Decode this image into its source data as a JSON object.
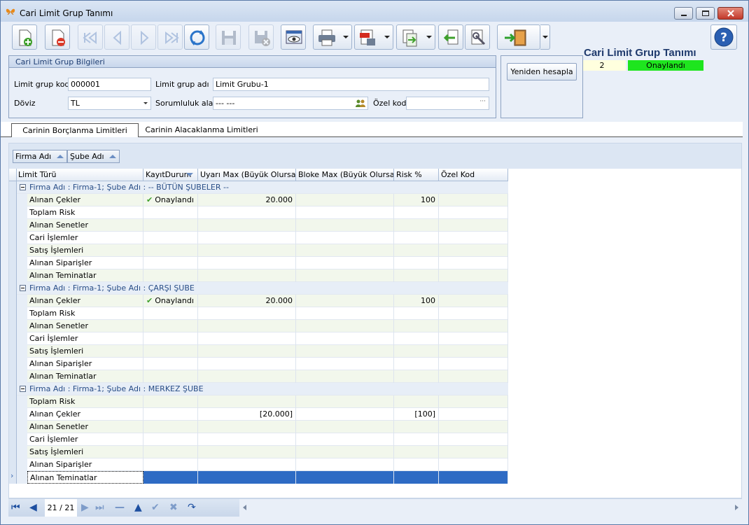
{
  "window": {
    "title": "Cari Limit Grup Tanımı"
  },
  "header": {
    "form_title": "Cari Limit Grup Tanımı",
    "record_no": "2",
    "status": "Onaylandı",
    "status_color": "#1ee51e"
  },
  "toolbar": {
    "icons": [
      "new-doc-icon",
      "delete-doc-icon",
      "first-icon",
      "prev-icon",
      "next-icon",
      "last-icon",
      "refresh-icon",
      "save-icon",
      "save-cancel-icon",
      "preview-icon",
      "print-icon",
      "pdf-icon",
      "export-icon",
      "import-icon",
      "settings-icon",
      "exit-icon",
      "help-icon"
    ]
  },
  "info": {
    "group_title": "Cari Limit Grup Bilgileri",
    "code_label": "Limit grup kodu",
    "code_value": "000001",
    "name_label": "Limit grup adı",
    "name_value": "Limit Grubu-1",
    "currency_label": "Döviz",
    "currency_value": "TL",
    "responsibility_label": "Sorumluluk alanı",
    "responsibility_value": "--- ---",
    "special_code_label": "Özel kod",
    "special_code_value": "",
    "recalc_label": "Yeniden hesapla"
  },
  "tabs": {
    "active": "Carinin Borçlanma Limitleri",
    "inactive": "Carinin Alacaklanma Limitleri"
  },
  "grouping": {
    "col1": "Firma Adı",
    "col2": "Şube Adı"
  },
  "grid": {
    "columns": [
      "Limit Türü",
      "KayıtDurum",
      "Uyarı Max (Büyük Olursa)",
      "Bloke Max (Büyük Olursa)",
      "Risk %",
      "Özel Kod"
    ],
    "groups": [
      {
        "label": "Firma Adı : Firma-1;  Şube Adı : -- BÜTÜN ŞUBELER --",
        "rows": [
          {
            "type": "Alınan Çekler",
            "status": "Onaylandı",
            "warn": "20.000",
            "block": "",
            "risk": "100",
            "code": ""
          },
          {
            "type": "Toplam Risk",
            "status": "",
            "warn": "",
            "block": "",
            "risk": "",
            "code": ""
          },
          {
            "type": "Alınan Senetler",
            "status": "",
            "warn": "",
            "block": "",
            "risk": "",
            "code": ""
          },
          {
            "type": "Cari İşlemler",
            "status": "",
            "warn": "",
            "block": "",
            "risk": "",
            "code": ""
          },
          {
            "type": "Satış İşlemleri",
            "status": "",
            "warn": "",
            "block": "",
            "risk": "",
            "code": ""
          },
          {
            "type": "Alınan Siparişler",
            "status": "",
            "warn": "",
            "block": "",
            "risk": "",
            "code": ""
          },
          {
            "type": "Alınan Teminatlar",
            "status": "",
            "warn": "",
            "block": "",
            "risk": "",
            "code": ""
          }
        ]
      },
      {
        "label": "Firma Adı : Firma-1;  Şube Adı : ÇARŞI ŞUBE",
        "rows": [
          {
            "type": "Alınan Çekler",
            "status": "Onaylandı",
            "warn": "20.000",
            "block": "",
            "risk": "100",
            "code": ""
          },
          {
            "type": "Toplam Risk",
            "status": "",
            "warn": "",
            "block": "",
            "risk": "",
            "code": ""
          },
          {
            "type": "Alınan Senetler",
            "status": "",
            "warn": "",
            "block": "",
            "risk": "",
            "code": ""
          },
          {
            "type": "Cari İşlemler",
            "status": "",
            "warn": "",
            "block": "",
            "risk": "",
            "code": ""
          },
          {
            "type": "Satış İşlemleri",
            "status": "",
            "warn": "",
            "block": "",
            "risk": "",
            "code": ""
          },
          {
            "type": "Alınan Siparişler",
            "status": "",
            "warn": "",
            "block": "",
            "risk": "",
            "code": ""
          },
          {
            "type": "Alınan Teminatlar",
            "status": "",
            "warn": "",
            "block": "",
            "risk": "",
            "code": ""
          }
        ]
      },
      {
        "label": "Firma Adı : Firma-1;  Şube Adı : MERKEZ ŞUBE",
        "rows": [
          {
            "type": "Toplam Risk",
            "status": "",
            "warn": "",
            "block": "",
            "risk": "",
            "code": ""
          },
          {
            "type": "Alınan Çekler",
            "status": "",
            "warn": "[20.000]",
            "block": "",
            "risk": "[100]",
            "code": ""
          },
          {
            "type": "Alınan Senetler",
            "status": "",
            "warn": "",
            "block": "",
            "risk": "",
            "code": ""
          },
          {
            "type": "Cari İşlemler",
            "status": "",
            "warn": "",
            "block": "",
            "risk": "",
            "code": ""
          },
          {
            "type": "Satış İşlemleri",
            "status": "",
            "warn": "",
            "block": "",
            "risk": "",
            "code": ""
          },
          {
            "type": "Alınan Siparişler",
            "status": "",
            "warn": "",
            "block": "",
            "risk": "",
            "code": ""
          },
          {
            "type": "Alınan Teminatlar",
            "status": "",
            "warn": "",
            "block": "",
            "risk": "",
            "code": "",
            "selected": true
          }
        ]
      }
    ]
  },
  "navigator": {
    "record_counter": "21 / 21"
  },
  "colors": {
    "selected_row": "#2e6bc4",
    "group_text": "#284d86",
    "title_text": "#1f3a6d"
  }
}
